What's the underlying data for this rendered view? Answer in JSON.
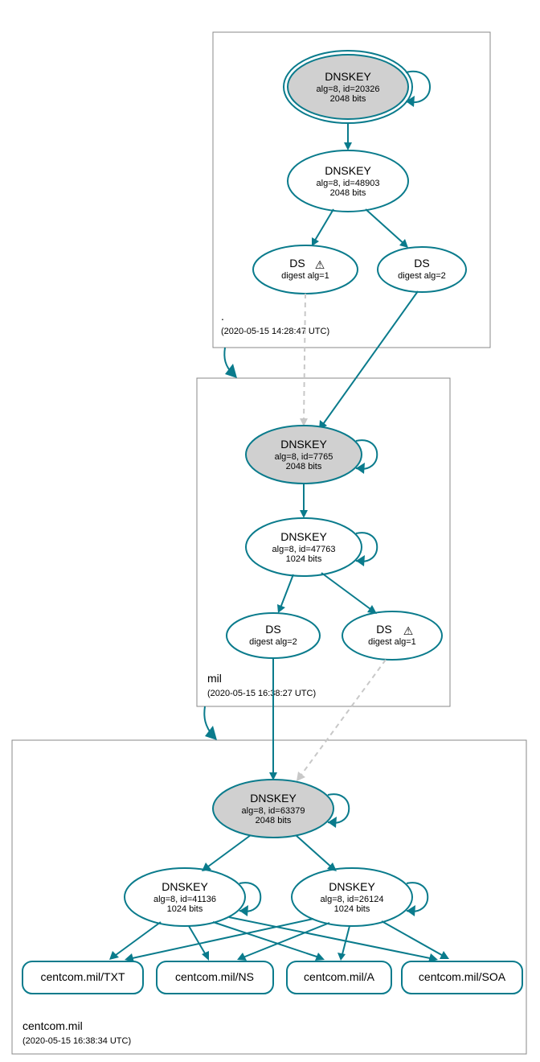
{
  "zones": {
    "root": {
      "label": ".",
      "timestamp": "(2020-05-15 14:28:47 UTC)"
    },
    "mil": {
      "label": "mil",
      "timestamp": "(2020-05-15 16:38:27 UTC)"
    },
    "centcom": {
      "label": "centcom.mil",
      "timestamp": "(2020-05-15 16:38:34 UTC)"
    }
  },
  "nodes": {
    "root_ksk": {
      "title": "DNSKEY",
      "sub1": "alg=8, id=20326",
      "sub2": "2048 bits"
    },
    "root_zsk": {
      "title": "DNSKEY",
      "sub1": "alg=8, id=48903",
      "sub2": "2048 bits"
    },
    "root_ds1": {
      "title": "DS",
      "sub1": "digest alg=1",
      "warn": "⚠"
    },
    "root_ds2": {
      "title": "DS",
      "sub1": "digest alg=2"
    },
    "mil_ksk": {
      "title": "DNSKEY",
      "sub1": "alg=8, id=7765",
      "sub2": "2048 bits"
    },
    "mil_zsk": {
      "title": "DNSKEY",
      "sub1": "alg=8, id=47763",
      "sub2": "1024 bits"
    },
    "mil_ds2": {
      "title": "DS",
      "sub1": "digest alg=2"
    },
    "mil_ds1": {
      "title": "DS",
      "sub1": "digest alg=1",
      "warn": "⚠"
    },
    "centcom_ksk": {
      "title": "DNSKEY",
      "sub1": "alg=8, id=63379",
      "sub2": "2048 bits"
    },
    "centcom_zsk1": {
      "title": "DNSKEY",
      "sub1": "alg=8, id=41136",
      "sub2": "1024 bits"
    },
    "centcom_zsk2": {
      "title": "DNSKEY",
      "sub1": "alg=8, id=26124",
      "sub2": "1024 bits"
    },
    "rr_txt": {
      "label": "centcom.mil/TXT"
    },
    "rr_ns": {
      "label": "centcom.mil/NS"
    },
    "rr_a": {
      "label": "centcom.mil/A"
    },
    "rr_soa": {
      "label": "centcom.mil/SOA"
    }
  }
}
